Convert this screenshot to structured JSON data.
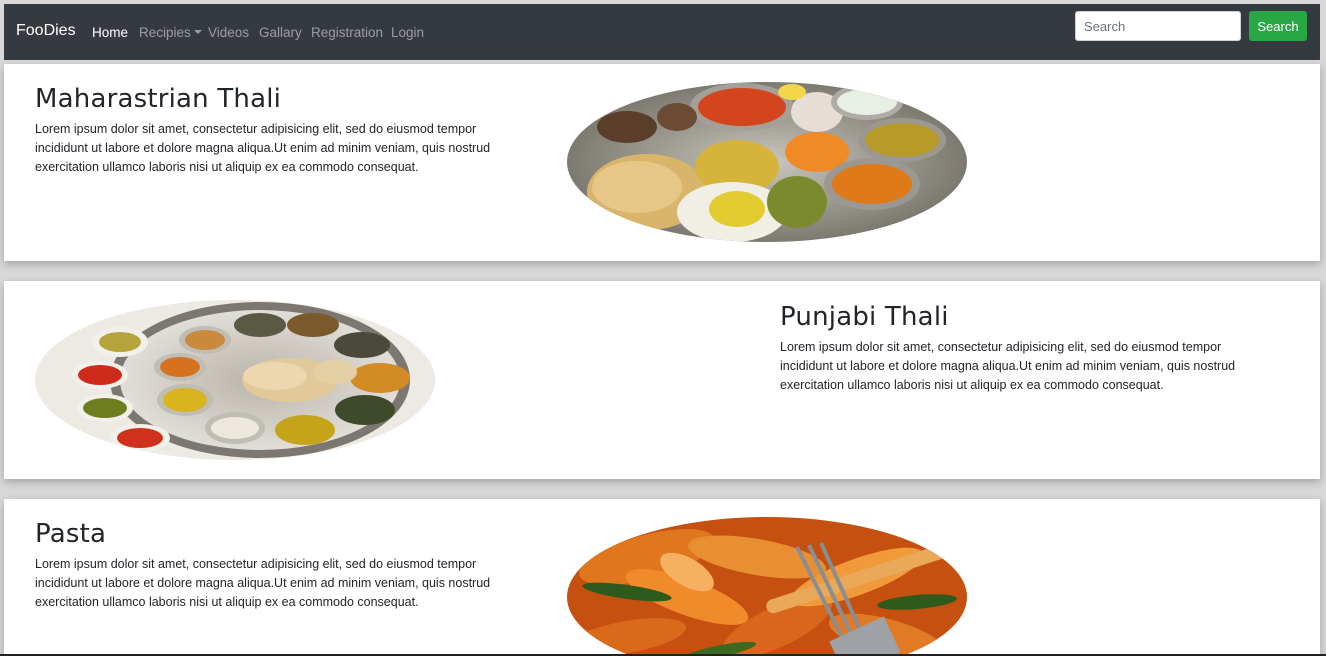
{
  "navbar": {
    "brand": "FooDies",
    "links": [
      {
        "label": "Home",
        "active": true
      },
      {
        "label": "Recipies",
        "dropdown": true
      },
      {
        "label": "Videos"
      },
      {
        "label": "Gallary"
      },
      {
        "label": "Registration"
      },
      {
        "label": "Login"
      }
    ],
    "search_placeholder": "Search",
    "search_button": "Search",
    "colors": {
      "bar": "#343a40",
      "search_button": "#28a745"
    }
  },
  "cards": [
    {
      "title": "Maharastrian Thali",
      "text": "Lorem ipsum dolor sit amet, consectetur adipisicing elit, sed do eiusmod tempor incididunt ut labore et dolore magna aliqua.Ut enim ad minim veniam, quis nostrud exercitation ullamco laboris nisi ut aliquip ex ea commodo consequat.",
      "image": "maharastrian-thali-image"
    },
    {
      "title": "Punjabi Thali",
      "text": "Lorem ipsum dolor sit amet, consectetur adipisicing elit, sed do eiusmod tempor incididunt ut labore et dolore magna aliqua.Ut enim ad minim veniam, quis nostrud exercitation ullamco laboris nisi ut aliquip ex ea commodo consequat.",
      "image": "punjabi-thali-image"
    },
    {
      "title": "Pasta",
      "text": "Lorem ipsum dolor sit amet, consectetur adipisicing elit, sed do eiusmod tempor incididunt ut labore et dolore magna aliqua.Ut enim ad minim veniam, quis nostrud exercitation ullamco laboris nisi ut aliquip ex ea commodo consequat.",
      "image": "pasta-image"
    }
  ]
}
